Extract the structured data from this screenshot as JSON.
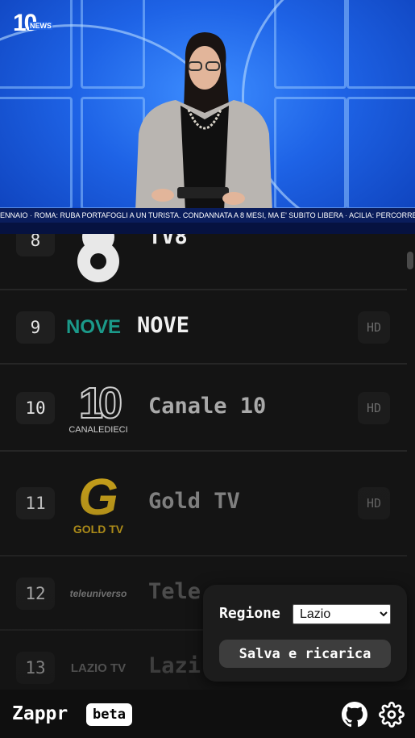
{
  "player": {
    "logo_big": "10",
    "logo_small": "NEWS",
    "ticker": "ENNAIO   ·   ROMA: RUBA PORTAFOGLI A UN TURISTA. CONDANNATA A 8 MESI, MA E' SUBITO LIBERA   ·   ACILIA: PERCORRE LA"
  },
  "channels": [
    {
      "number": "8",
      "name": "TV8",
      "hd": "",
      "logo_text": "8"
    },
    {
      "number": "9",
      "name": "NOVE",
      "hd": "HD",
      "logo_text": "NOVE"
    },
    {
      "number": "10",
      "name": "Canale 10",
      "hd": "HD",
      "logo_text": "10",
      "logo_subtext": "CANALEDIECI"
    },
    {
      "number": "11",
      "name": "Gold TV",
      "hd": "HD",
      "logo_text": "G",
      "logo_subtext": "GOLD TV"
    },
    {
      "number": "12",
      "name": "Tele",
      "hd": "",
      "logo_text": "teleuniverso"
    },
    {
      "number": "13",
      "name": "Lazi",
      "hd": "",
      "logo_text": "LAZIO TV"
    }
  ],
  "settings": {
    "region_label": "Regione",
    "region_value": "Lazio",
    "save_label": "Salva e ricarica"
  },
  "bottom_bar": {
    "app_name": "Zappr",
    "badge": "beta"
  },
  "colors": {
    "background": "#141414",
    "player_blue": "#1e63e6",
    "nove_teal": "#1b9a8a",
    "gold": "#c9a21a"
  }
}
